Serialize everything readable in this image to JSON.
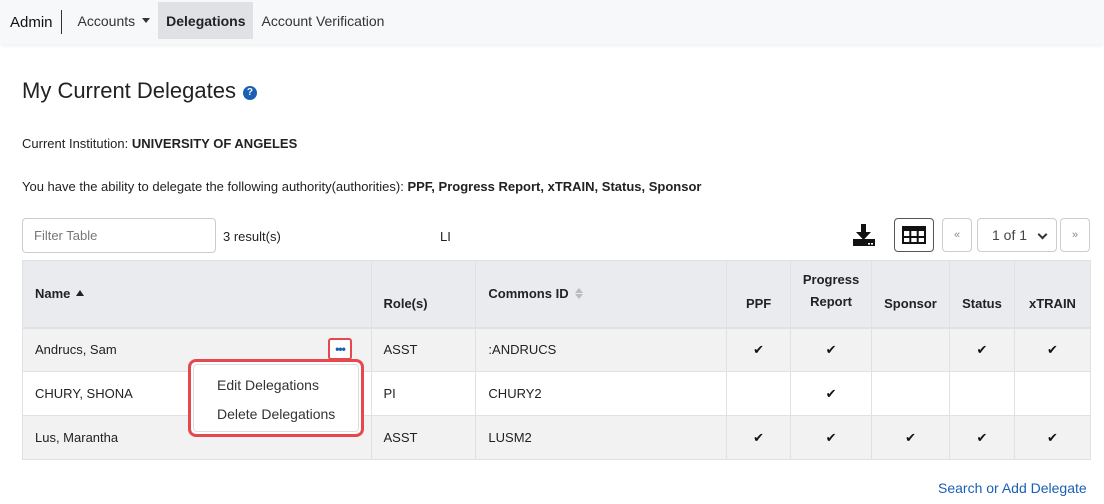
{
  "nav": {
    "brand": "Admin",
    "items": [
      {
        "label": "Accounts",
        "dropdown": true
      },
      {
        "label": "Delegations",
        "active": true
      },
      {
        "label": "Account Verification"
      }
    ]
  },
  "page": {
    "title": "My Current Delegates",
    "help_icon": "?",
    "institution_label": "Current Institution:",
    "institution_value": "UNIVERSITY OF  ANGELES",
    "authority_label": "You have the ability to delegate the following authority(authorities):",
    "authority_value": "PPF, Progress Report, xTRAIN, Status, Sponsor"
  },
  "toolbar": {
    "filter_placeholder": "Filter Table",
    "results": "3 result(s)",
    "stray_text": "LI",
    "pagination": {
      "prev": "«",
      "current": "1 of 1",
      "next": "»"
    }
  },
  "table": {
    "columns": [
      {
        "label": "Name",
        "sort": "asc"
      },
      {
        "label": "Role(s)"
      },
      {
        "label": "Commons ID",
        "sort": "none"
      },
      {
        "label": "PPF"
      },
      {
        "label": "Progress Report"
      },
      {
        "label": "Sponsor"
      },
      {
        "label": "Status"
      },
      {
        "label": "xTRAIN"
      }
    ],
    "rows": [
      {
        "name": "Andrucs, Sam",
        "role": "ASST",
        "commons_id": ":ANDRUCS",
        "ppf": "✔",
        "progress": "✔",
        "sponsor": "",
        "status": "✔",
        "xtrain": "✔"
      },
      {
        "name": "CHURY, SHONA",
        "role": "PI",
        "commons_id": "CHURY2",
        "ppf": "",
        "progress": "✔",
        "sponsor": "",
        "status": "",
        "xtrain": ""
      },
      {
        "name": "Lus, Marantha",
        "role": "ASST",
        "commons_id": "LUSM2",
        "ppf": "✔",
        "progress": "✔",
        "sponsor": "✔",
        "status": "✔",
        "xtrain": "✔"
      }
    ]
  },
  "row_menu": {
    "trigger": "•••",
    "items": [
      "Edit Delegations",
      "Delete Delegations"
    ]
  },
  "footer": {
    "link": "Search or Add Delegate"
  },
  "colors": {
    "accent": "#1a5fb4",
    "highlight": "#e5484d"
  }
}
